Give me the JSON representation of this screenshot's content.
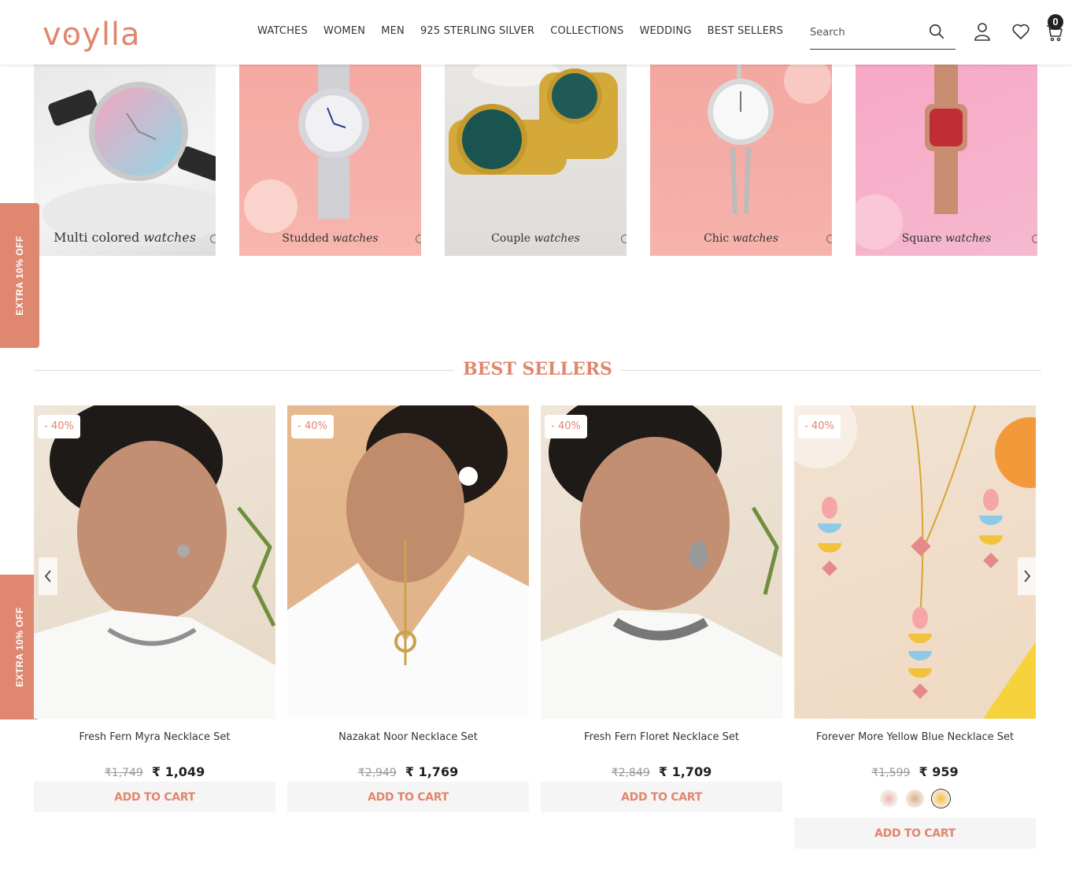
{
  "header": {
    "logo_text": "voylla",
    "nav": [
      "WATCHES",
      "WOMEN",
      "MEN",
      "925 STERLING SILVER",
      "COLLECTIONS",
      "WEDDING",
      "BEST SELLERS"
    ],
    "search_placeholder": "Search",
    "cart_count": "0",
    "icons": [
      "search-icon",
      "user-icon",
      "heart-icon",
      "cart-icon"
    ]
  },
  "categories": [
    {
      "label_main": "Multi colored",
      "label_italic": "watches"
    },
    {
      "label_main": "Studded",
      "label_italic": "watches"
    },
    {
      "label_main": "Couple",
      "label_italic": "watches"
    },
    {
      "label_main": "Chic",
      "label_italic": "watches"
    },
    {
      "label_main": "Square",
      "label_italic": "watches"
    }
  ],
  "side_tab": {
    "label": "EXTRA 10% OFF"
  },
  "best_sellers": {
    "title": "BEST SELLERS",
    "products": [
      {
        "badge": "- 40%",
        "name": "Fresh Fern Myra Necklace Set",
        "old_price": "₹1,749",
        "price": "₹ 1,049",
        "cta": "ADD TO CART"
      },
      {
        "badge": "- 40%",
        "name": "Nazakat Noor Necklace Set",
        "old_price": "₹2,949",
        "price": "₹ 1,769",
        "cta": "ADD TO CART"
      },
      {
        "badge": "- 40%",
        "name": "Fresh Fern Floret Necklace Set",
        "old_price": "₹2,849",
        "price": "₹ 1,709",
        "cta": "ADD TO CART"
      },
      {
        "badge": "- 40%",
        "name": "Forever More Yellow Blue Necklace Set",
        "old_price": "₹1,599",
        "price": "₹ 959",
        "cta": "ADD TO CART"
      }
    ]
  },
  "colors": {
    "accent": "#e0876f"
  }
}
